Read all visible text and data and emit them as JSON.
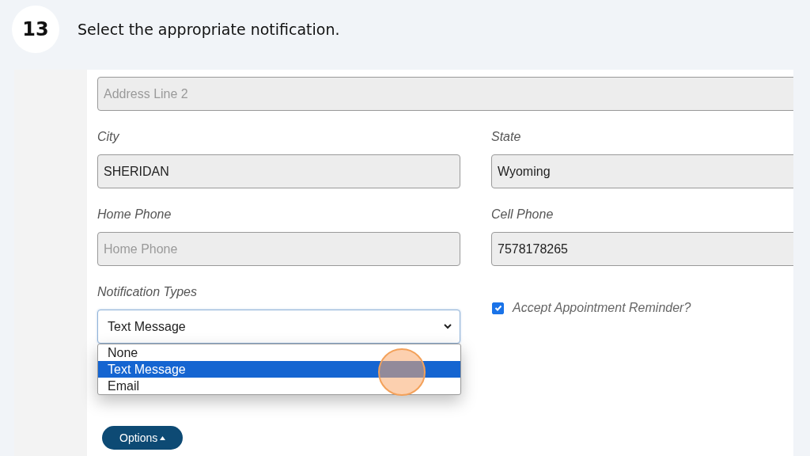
{
  "step": {
    "number": "13",
    "instruction": "Select the appropriate notification."
  },
  "form": {
    "rows": [
      {
        "fields": [
          {
            "placeholder": "Address Line 2"
          }
        ]
      },
      {
        "fields": [
          {
            "label": "City",
            "value": "SHERIDAN"
          },
          {
            "label": "State",
            "value": "Wyoming"
          }
        ]
      },
      {
        "fields": [
          {
            "label": "Home Phone",
            "placeholder": "Home Phone"
          },
          {
            "label": "Cell Phone",
            "value": "7578178265"
          }
        ]
      }
    ],
    "notification": {
      "label": "Notification Types",
      "value": "Text Message",
      "expanded": true,
      "options": [
        {
          "label": "None",
          "selected": false
        },
        {
          "label": "Text Message",
          "selected": true
        },
        {
          "label": "Email",
          "selected": false
        }
      ]
    },
    "reminder": {
      "label": "Accept Appointment Reminder?",
      "checked": true
    },
    "options_button": {
      "label": "Options"
    }
  }
}
